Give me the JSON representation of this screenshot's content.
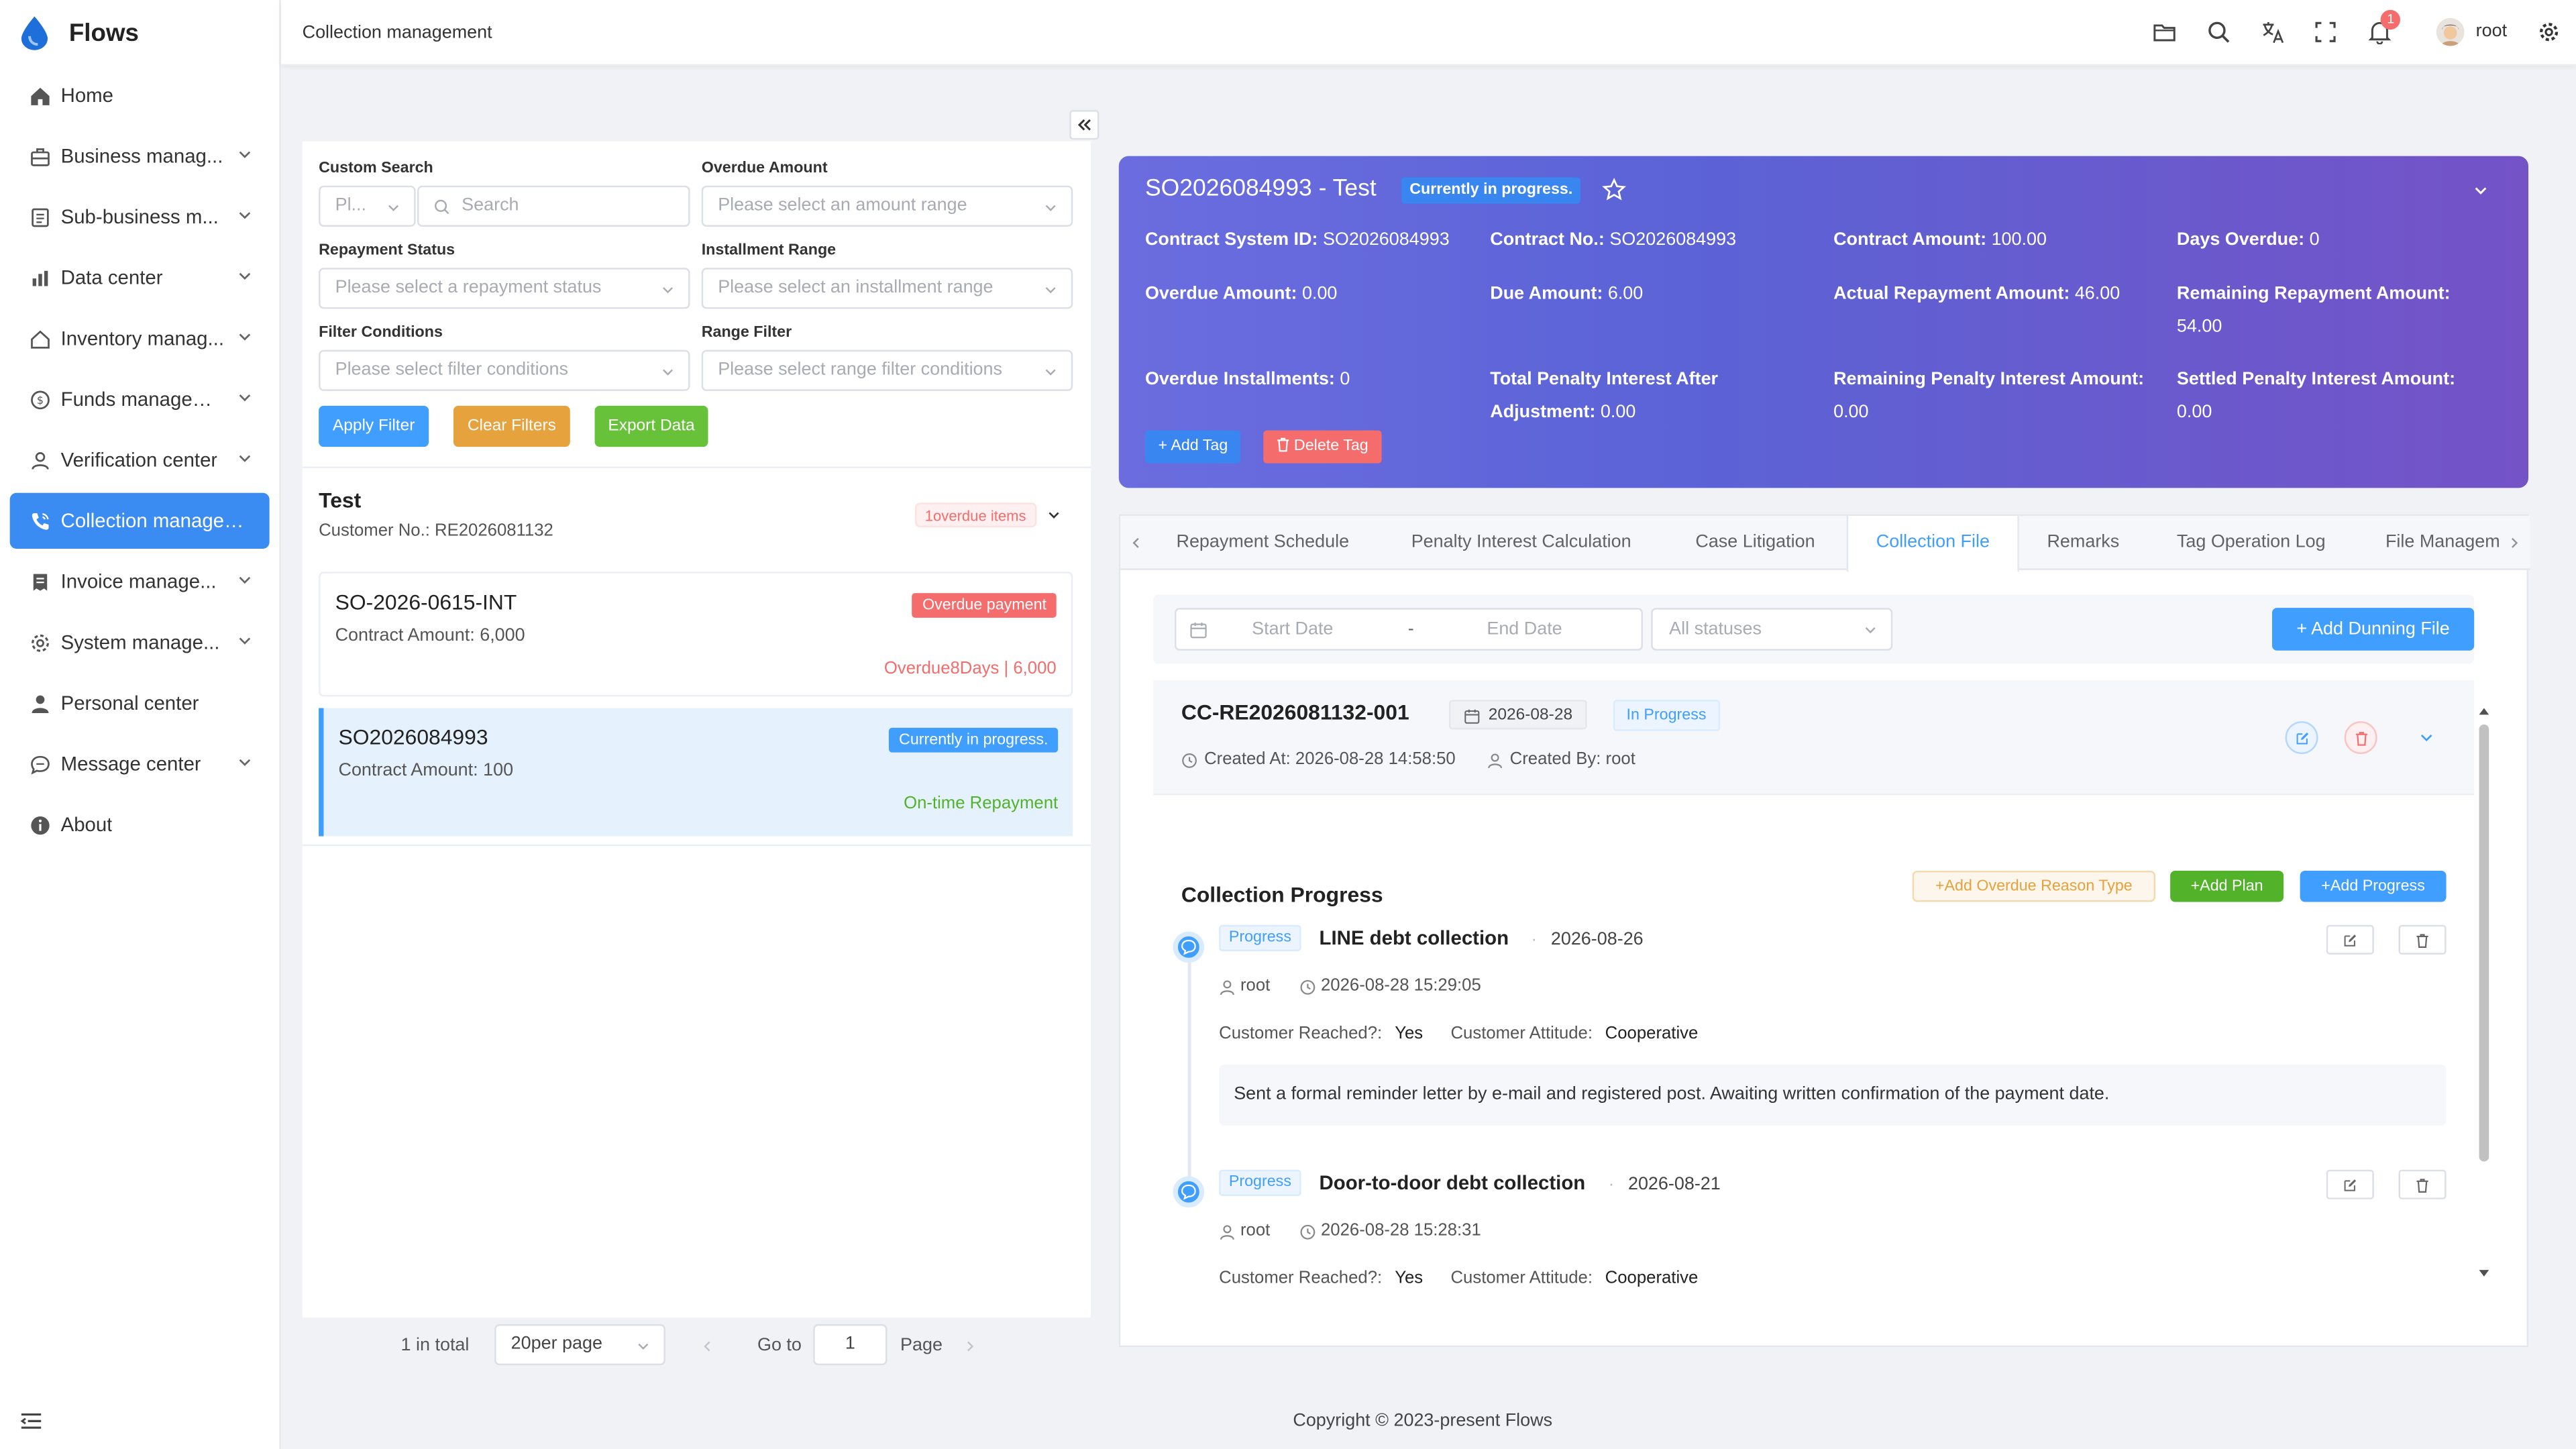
{
  "app": {
    "name": "Flows"
  },
  "sidebar": {
    "items": [
      {
        "label": "Home"
      },
      {
        "label": "Business manag..."
      },
      {
        "label": "Sub-business m..."
      },
      {
        "label": "Data center"
      },
      {
        "label": "Inventory manag..."
      },
      {
        "label": "Funds managem..."
      },
      {
        "label": "Verification center"
      },
      {
        "label": "Collection managem..."
      },
      {
        "label": "Invoice manage..."
      },
      {
        "label": "System manage..."
      },
      {
        "label": "Personal center"
      },
      {
        "label": "Message center"
      },
      {
        "label": "About"
      }
    ]
  },
  "header": {
    "breadcrumb": "Collection management",
    "notifications": "1",
    "user": "root"
  },
  "filters": {
    "custom_search_label": "Custom Search",
    "custom_search_select": "Pl...",
    "search_placeholder": "Search",
    "overdue_amount_label": "Overdue Amount",
    "overdue_amount_placeholder": "Please select an amount range",
    "repayment_status_label": "Repayment Status",
    "repayment_status_placeholder": "Please select a repayment status",
    "installment_range_label": "Installment Range",
    "installment_range_placeholder": "Please select an installment range",
    "filter_conditions_label": "Filter Conditions",
    "filter_conditions_placeholder": "Please select filter conditions",
    "range_filter_label": "Range Filter",
    "range_filter_placeholder": "Please select range filter conditions",
    "apply": "Apply Filter",
    "clear": "Clear Filters",
    "export": "Export Data"
  },
  "customer": {
    "name": "Test",
    "number": "Customer No.: RE2026081132",
    "overdue_tag": "1overdue items"
  },
  "contracts": [
    {
      "id": "SO-2026-0615-INT",
      "amount": "Contract Amount: 6,000",
      "badge": "Overdue payment",
      "foot": "Overdue8Days | 6,000"
    },
    {
      "id": "SO2026084993",
      "amount": "Contract Amount: 100",
      "badge": "Currently in progress.",
      "foot": "On-time Repayment"
    }
  ],
  "pager": {
    "total": "1 in total",
    "per_page": "20per page",
    "goto": "Go to",
    "page_value": "1",
    "page_word": "Page"
  },
  "detail": {
    "title": "SO2026084993  - Test",
    "status": "Currently in progress.",
    "fields": [
      {
        "k": "Contract System ID:",
        "v": "SO2026084993"
      },
      {
        "k": "Contract No.:",
        "v": "SO2026084993"
      },
      {
        "k": "Contract Amount:",
        "v": "100.00"
      },
      {
        "k": "Days Overdue:",
        "v": "0"
      },
      {
        "k": "Overdue Amount:",
        "v": "0.00"
      },
      {
        "k": "Due Amount:",
        "v": "6.00"
      },
      {
        "k": "Actual Repayment Amount:",
        "v": "46.00"
      },
      {
        "k": "Remaining Repayment Amount:",
        "v": "54.00"
      },
      {
        "k": "Overdue Installments:",
        "v": "0"
      },
      {
        "k": "Total Penalty Interest After Adjustment:",
        "v": "0.00"
      },
      {
        "k": "Remaining Penalty Interest Amount:",
        "v": "0.00"
      },
      {
        "k": "Settled Penalty Interest Amount:",
        "v": "0.00"
      }
    ],
    "add_tag": "Add Tag",
    "delete_tag": "Delete Tag"
  },
  "tabs": [
    "Repayment Schedule",
    "Penalty Interest Calculation",
    "Case Litigation",
    "Collection File",
    "Remarks",
    "Tag Operation Log",
    "File Managem"
  ],
  "file_filter": {
    "start": "Start Date",
    "sep": "-",
    "end": "End Date",
    "status": "All statuses",
    "add": "+ Add Dunning File"
  },
  "file": {
    "id": "CC-RE2026081132-001",
    "date": "2026-08-28",
    "status": "In Progress",
    "created_at": "Created At: 2026-08-28 14:58:50",
    "created_by": "Created By: root"
  },
  "progress": {
    "title": "Collection Progress",
    "add_reason": "+Add Overdue Reason Type",
    "add_plan": "+Add Plan",
    "add_progress": "+Add Progress",
    "items": [
      {
        "tag": "Progress",
        "title": "LINE debt collection",
        "date": "2026-08-26",
        "user": "root",
        "time": "2026-08-28 15:29:05",
        "reached_k": "Customer Reached?:",
        "reached_v": "Yes",
        "attitude_k": "Customer Attitude:",
        "attitude_v": "Cooperative",
        "note": "Sent a formal reminder letter by e-mail and registered post. Awaiting written confirmation of the payment date."
      },
      {
        "tag": "Progress",
        "title": "Door-to-door debt collection",
        "date": "2026-08-21",
        "user": "root",
        "time": "2026-08-28 15:28:31",
        "reached_k": "Customer Reached?:",
        "reached_v": "Yes",
        "attitude_k": "Customer Attitude:",
        "attitude_v": "Cooperative"
      }
    ]
  },
  "footer": "Copyright © 2023-present Flows",
  "colors": {
    "primary": "#409eff",
    "active_menu": "#3b8cf2",
    "warning": "#e6a23c",
    "success": "#67c23a",
    "danger": "#f56c6c"
  }
}
